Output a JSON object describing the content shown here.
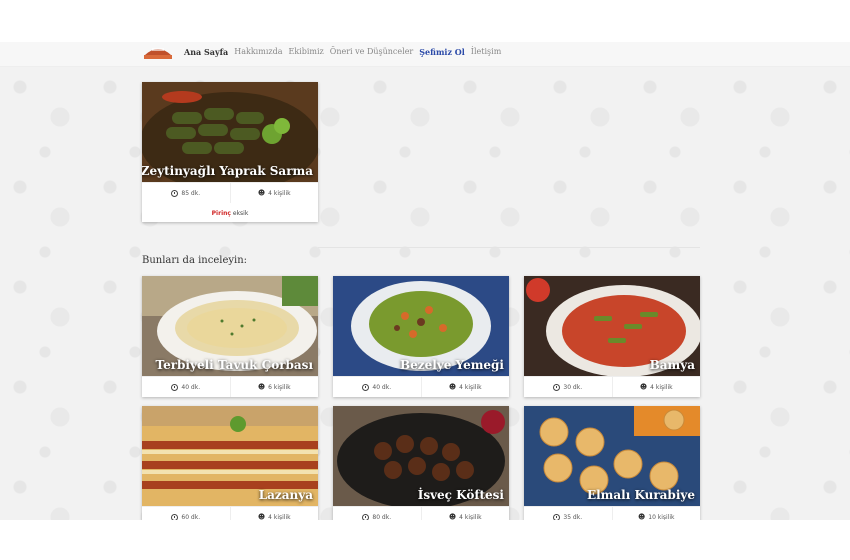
{
  "nav": {
    "items": [
      "Ana Sayfa",
      "Hakkımızda",
      "Ekibimiz",
      "Öneri ve Düşünceler",
      "Şefimiz Ol",
      "İletişim"
    ]
  },
  "featured": {
    "title": "Zeytinyağlı Yaprak Sarma",
    "time": "85 dk.",
    "servings": "4 kişilik",
    "missing_ingredient": "Pirinç",
    "missing_suffix": "eksik"
  },
  "section_title": "Bunları da inceleyin:",
  "recipes": [
    {
      "title": "Terbiyeli Tavuk Çorbası",
      "time": "40 dk.",
      "servings": "6 kişilik"
    },
    {
      "title": "Bezelye Yemeği",
      "time": "40 dk.",
      "servings": "4 kişilik"
    },
    {
      "title": "Bamya",
      "time": "30 dk.",
      "servings": "4 kişilik"
    },
    {
      "title": "Lazanya",
      "time": "60 dk.",
      "servings": "4 kişilik"
    },
    {
      "title": "İsveç Köftesi",
      "time": "80 dk.",
      "servings": "4 kişilik"
    },
    {
      "title": "Elmalı Kurabiye",
      "time": "35 dk.",
      "servings": "10 kişilik"
    }
  ]
}
